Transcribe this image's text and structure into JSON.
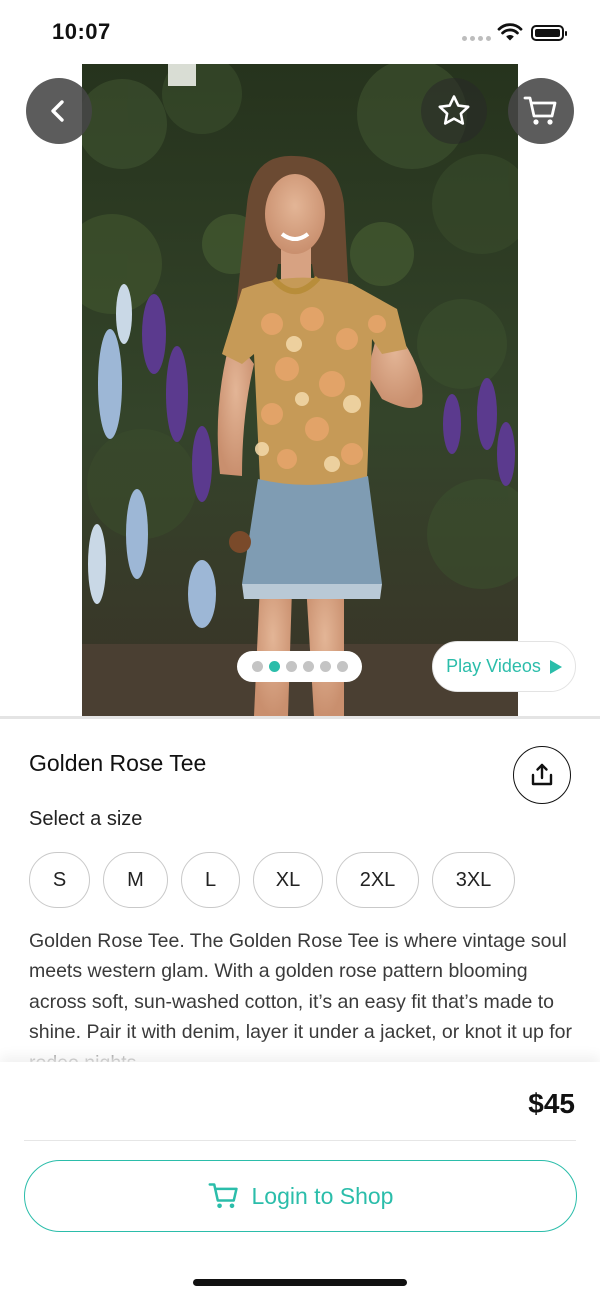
{
  "status_bar": {
    "time": "10:07",
    "icons": [
      "signal-dots-icon",
      "wifi-icon",
      "battery-icon"
    ]
  },
  "product": {
    "title": "Golden Rose Tee",
    "size_label": "Select a size",
    "sizes": [
      "S",
      "M",
      "L",
      "XL",
      "2XL",
      "3XL"
    ],
    "description": "Golden Rose Tee. The Golden Rose Tee is where vintage soul meets western glam. With a golden rose pattern blooming across soft, sun-washed cotton, it’s an easy fit that’s made to shine. Pair it with denim, layer it under a jacket, or knot it up for rodeo nights.",
    "price": "$45"
  },
  "gallery": {
    "image_count": 6,
    "active_index": 1,
    "play_videos_label": "Play Videos"
  },
  "actions": {
    "login_label": "Login to Shop"
  },
  "colors": {
    "accent": "#2bbdaa",
    "text": "#111111",
    "overlay_button": "#464646"
  }
}
